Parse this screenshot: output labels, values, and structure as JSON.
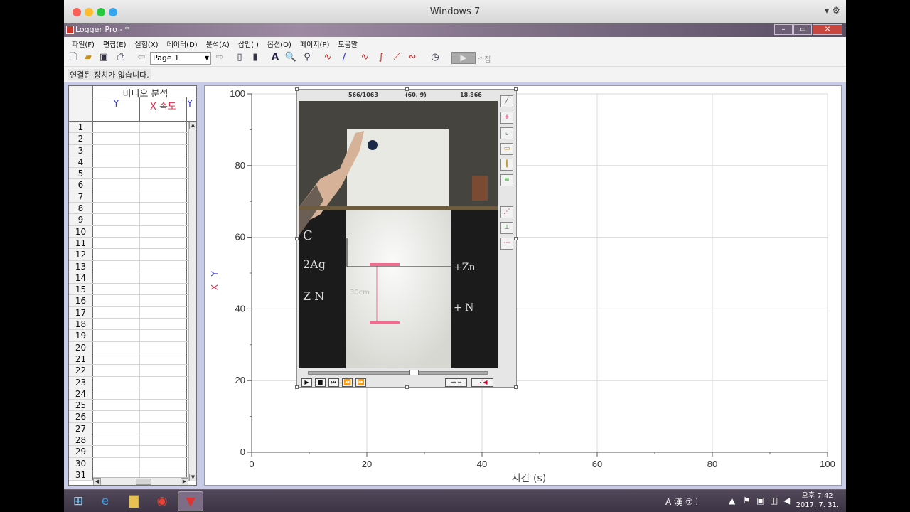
{
  "host": {
    "title": "Windows 7",
    "controls": "▾ ⚙",
    "dots": [
      "#fc5f57",
      "#fdbc2e",
      "#28c840",
      "#34a7f0"
    ]
  },
  "app": {
    "title": "Logger Pro - *",
    "min": "–",
    "max": "▭",
    "close": "✕"
  },
  "menu": [
    "파일(F)",
    "편집(E)",
    "실험(X)",
    "데이터(D)",
    "분석(A)",
    "삽입(I)",
    "옵션(O)",
    "페이지(P)",
    "도움말"
  ],
  "toolbar": {
    "page": "Page 1",
    "collect_label": "수집",
    "collect_icon": "▶"
  },
  "status": "연결된 장치가 없습니다.",
  "table": {
    "group": "비디오 분석",
    "columns": [
      {
        "label": "Y",
        "color": "#3b3bd8"
      },
      {
        "label": "X 속도",
        "color": "#e6284d"
      },
      {
        "label": "Y",
        "color": "#3b3bd8"
      }
    ],
    "rows": [
      "1",
      "2",
      "3",
      "4",
      "5",
      "6",
      "7",
      "8",
      "9",
      "10",
      "11",
      "12",
      "13",
      "14",
      "15",
      "16",
      "17",
      "18",
      "19",
      "20",
      "21",
      "22",
      "23",
      "24",
      "25",
      "26",
      "27",
      "28",
      "29",
      "30",
      "31"
    ]
  },
  "graph": {
    "ylabel_x": "X",
    "ylabel_y": "Y",
    "xlabel": "시간 (s)",
    "x_ticks": [
      "0",
      "20",
      "40",
      "60",
      "80",
      "100"
    ],
    "y_ticks": [
      "0",
      "20",
      "40",
      "60",
      "80",
      "100"
    ],
    "xlim": [
      0,
      100
    ],
    "ylim": [
      0,
      100
    ]
  },
  "video": {
    "frame": "566/1063",
    "coords": "(60, 9)",
    "time": "18.866"
  },
  "taskbar": {
    "time": "오후 7:42",
    "date": "2017. 7. 31.",
    "ime": "A 漢 ⑦ ⁚"
  }
}
